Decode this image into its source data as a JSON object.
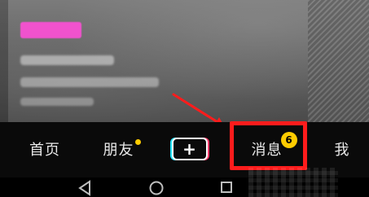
{
  "bottom_nav": {
    "items": [
      {
        "label": "首页"
      },
      {
        "label": "朋友"
      },
      {
        "label": "+"
      },
      {
        "label": "消息",
        "badge_count": "6"
      },
      {
        "label": "我"
      }
    ],
    "dot_badge_color": "#ffcc00",
    "count_badge_color": "#ffcc00"
  },
  "annotation": {
    "highlight_color": "#ff1c1c",
    "arrow_color": "#ff1c1c"
  },
  "system_nav": {
    "icons": [
      "back-triangle-icon",
      "home-circle-icon",
      "recent-square-icon"
    ]
  }
}
